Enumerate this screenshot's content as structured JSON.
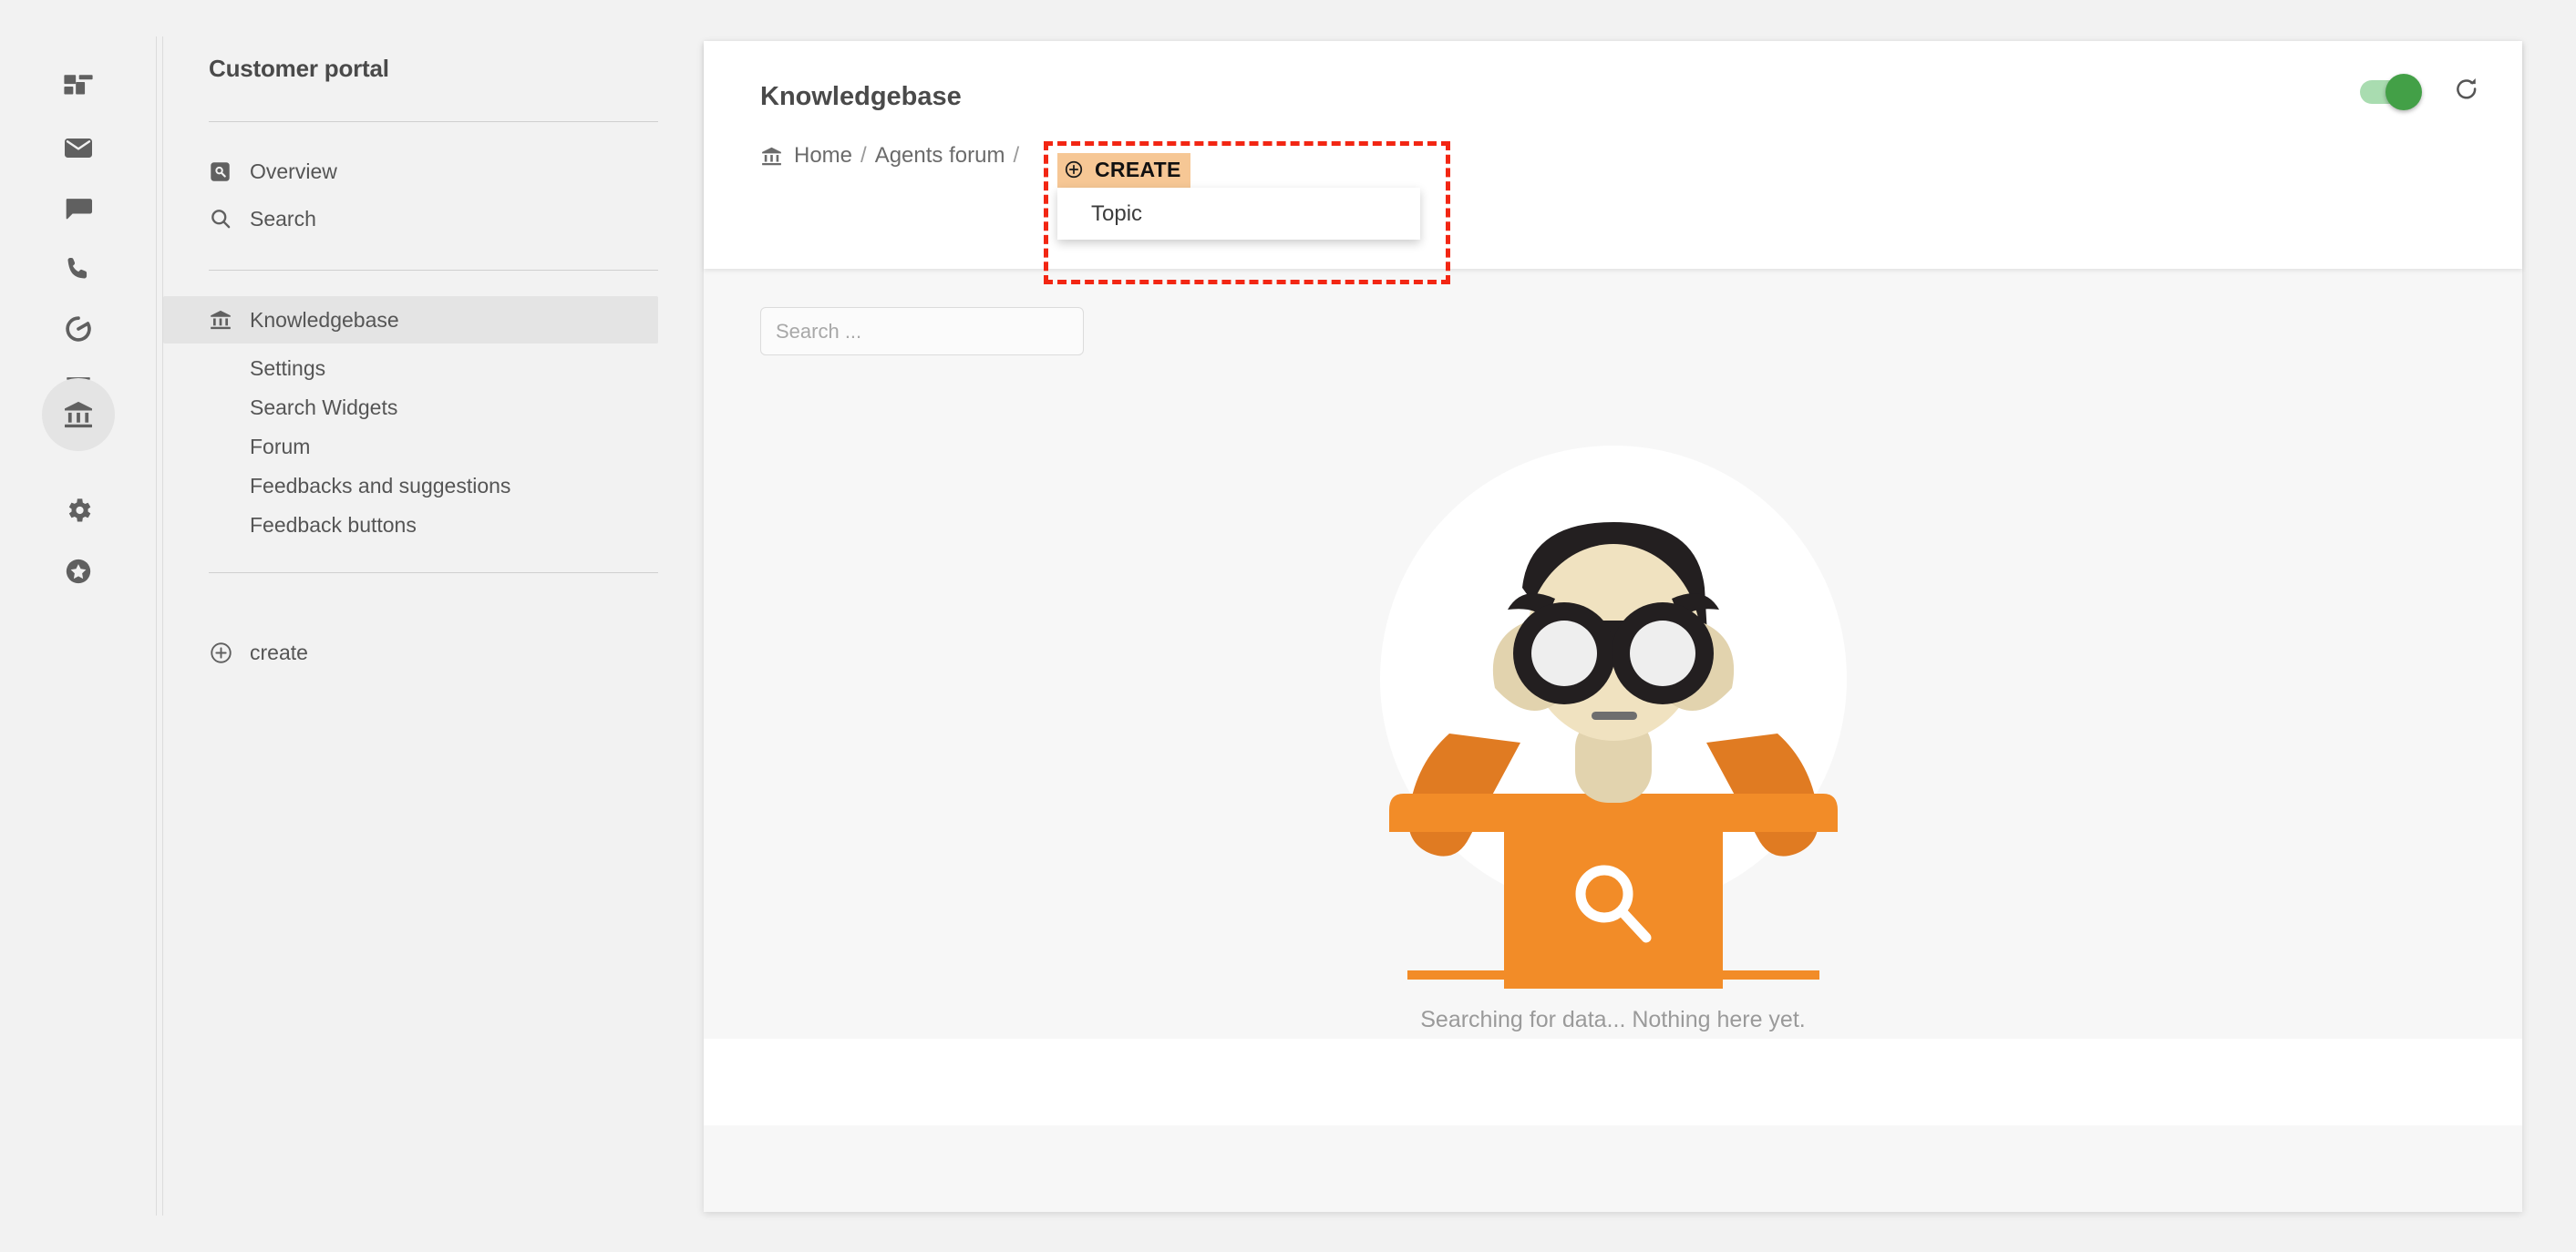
{
  "icon_rail": {
    "items": [
      {
        "name": "dashboard",
        "icon": "dashboard-icon",
        "active": false
      },
      {
        "name": "mail",
        "icon": "mail-icon",
        "active": false
      },
      {
        "name": "chat",
        "icon": "chat-icon",
        "active": false
      },
      {
        "name": "phone",
        "icon": "phone-icon",
        "active": false
      },
      {
        "name": "reports",
        "icon": "donut-chart-icon",
        "active": false
      },
      {
        "name": "contacts",
        "icon": "contact-card-icon",
        "active": false
      },
      {
        "name": "knowledgebase",
        "icon": "bank-icon",
        "active": true
      },
      {
        "name": "settings",
        "icon": "gear-icon",
        "active": false
      },
      {
        "name": "favorites",
        "icon": "star-circle-icon",
        "active": false
      }
    ]
  },
  "sidebar": {
    "title": "Customer portal",
    "nav": [
      {
        "label": "Overview",
        "icon": "overview-icon"
      },
      {
        "label": "Search",
        "icon": "search-icon"
      }
    ],
    "section": {
      "label": "Knowledgebase",
      "icon": "bank-icon",
      "selected": true,
      "children": [
        {
          "label": "Settings"
        },
        {
          "label": "Search Widgets"
        },
        {
          "label": "Forum"
        },
        {
          "label": "Feedbacks and suggestions"
        },
        {
          "label": "Feedback buttons"
        }
      ]
    },
    "create": {
      "label": "create",
      "icon": "plus-circle-icon"
    }
  },
  "main": {
    "page_title": "Knowledgebase",
    "breadcrumb": {
      "icon": "bank-icon",
      "items": [
        "Home",
        "Agents forum"
      ],
      "separator": "/"
    },
    "create_menu": {
      "badge_label": "CREATE",
      "badge_icon": "plus-circle-icon",
      "badge_bg": "#f6c795",
      "items": [
        {
          "label": "Topic"
        }
      ],
      "open": true
    },
    "annotation": {
      "color": "#f22613",
      "style": "dashed"
    },
    "header_controls": {
      "toggle": {
        "name": "visibility-toggle",
        "state": "on",
        "on_color": "#43a047",
        "track_color": "#a9dcb0"
      },
      "refresh": {
        "name": "refresh-button",
        "icon": "refresh-icon"
      }
    },
    "search": {
      "value": "",
      "placeholder": "Search ..."
    },
    "empty_state": {
      "illustration": "person-with-binoculars-illustration",
      "message": "Searching for data... Nothing here yet.",
      "colors": {
        "shirt": "#f28c28",
        "arm": "#e07b22",
        "skin": "#f0e2c0",
        "skin_hands": "#e2d3ae",
        "hair": "#231f20",
        "circle": "#ffffff"
      }
    }
  }
}
